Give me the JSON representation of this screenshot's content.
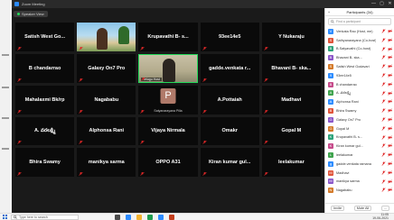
{
  "window": {
    "title": "Zoom Meeting",
    "controls": [
      "—",
      "▢",
      "✕"
    ]
  },
  "view_pill": {
    "label": "Speaker View"
  },
  "grid": {
    "tiles": [
      {
        "name": "Satish West Go...",
        "kind": "name"
      },
      {
        "name": "",
        "kind": "video-beach"
      },
      {
        "name": "Krupavathi B- s...",
        "kind": "name"
      },
      {
        "name": "93ee14e5",
        "kind": "name"
      },
      {
        "name": "Y Nukaraju",
        "kind": "name"
      },
      {
        "name": "B chandarrao",
        "kind": "name"
      },
      {
        "name": "Galaxy On7 Pro",
        "kind": "name"
      },
      {
        "name": "",
        "kind": "video-room",
        "label": "Telugu Host"
      },
      {
        "name": "gadde.venkata r...",
        "kind": "name"
      },
      {
        "name": "Bhavani B- ska...",
        "kind": "name"
      },
      {
        "name": "Mahalaxmi Bk/rp",
        "kind": "name"
      },
      {
        "name": "Nagababu",
        "kind": "name"
      },
      {
        "name": "",
        "kind": "initial",
        "initial": "P",
        "sub": "Satyanarayana Pilla"
      },
      {
        "name": "A.Pottaiah",
        "kind": "name"
      },
      {
        "name": "Madhavi",
        "kind": "name"
      },
      {
        "name": "A. వరలక్ష్మి",
        "kind": "name"
      },
      {
        "name": "Alphonsa Rani",
        "kind": "name"
      },
      {
        "name": "Vijaya Nirmala",
        "kind": "name"
      },
      {
        "name": "Omakr",
        "kind": "name"
      },
      {
        "name": "Gopal M",
        "kind": "name"
      },
      {
        "name": "Bhira Swamy",
        "kind": "name"
      },
      {
        "name": "manikya sarma",
        "kind": "name"
      },
      {
        "name": "OPPO A31",
        "kind": "name"
      },
      {
        "name": "Kiran kumar gul...",
        "kind": "name"
      },
      {
        "name": "leelakumar",
        "kind": "name"
      }
    ]
  },
  "participants_panel": {
    "title": "Participants (34)",
    "search_placeholder": "Find a participant",
    "participants": [
      {
        "initial": "V",
        "name": "Venkata Rao (Host, me)",
        "color": "#2d8cff"
      },
      {
        "initial": "S",
        "name": "Sathyanarayana (Co-host)",
        "color": "#e0543a"
      },
      {
        "initial": "B",
        "name": "B.Satyavathi (Co-host)",
        "color": "#2da37a"
      },
      {
        "initial": "B",
        "name": "Bhavani B- ska...",
        "color": "#8a56c8"
      },
      {
        "initial": "S",
        "name": "Satish West Godavari",
        "color": "#d47a2a"
      },
      {
        "initial": "9",
        "name": "93ee14e5",
        "color": "#2d8cff"
      },
      {
        "initial": "B",
        "name": "B chandarrao",
        "color": "#c64a8a"
      },
      {
        "initial": "A",
        "name": "A. వరలక్ష్మి",
        "color": "#3fa34d"
      },
      {
        "initial": "A",
        "name": "Alphonsa Rani",
        "color": "#2d8cff"
      },
      {
        "initial": "B",
        "name": "Bhira Swamy",
        "color": "#e0543a"
      },
      {
        "initial": "G",
        "name": "Galaxy On7 Pro",
        "color": "#8a56c8"
      },
      {
        "initial": "G",
        "name": "Gopal M",
        "color": "#d47a2a"
      },
      {
        "initial": "K",
        "name": "Krupavathi B- s...",
        "color": "#2da37a"
      },
      {
        "initial": "K",
        "name": "Kiran kumar gul...",
        "color": "#c64a8a"
      },
      {
        "initial": "L",
        "name": "leelakumar",
        "color": "#3fa34d"
      },
      {
        "initial": "g",
        "name": "gadde.venkata ramana",
        "color": "#2d8cff"
      },
      {
        "initial": "M",
        "name": "Madhavi",
        "color": "#e0543a"
      },
      {
        "initial": "M",
        "name": "manikya sarma",
        "color": "#8a56c8"
      },
      {
        "initial": "N",
        "name": "Nagababu",
        "color": "#d47a2a"
      }
    ],
    "footer": {
      "invite": "Invite",
      "mute_all": "Mute All",
      "more": "..."
    }
  },
  "taskbar": {
    "search_placeholder": "Type here to search",
    "time": "11:05",
    "date": "19-06-2021"
  },
  "colors": {
    "accent_blue": "#2d8cff",
    "muted_red": "#e02828",
    "active_green": "#23d959"
  }
}
